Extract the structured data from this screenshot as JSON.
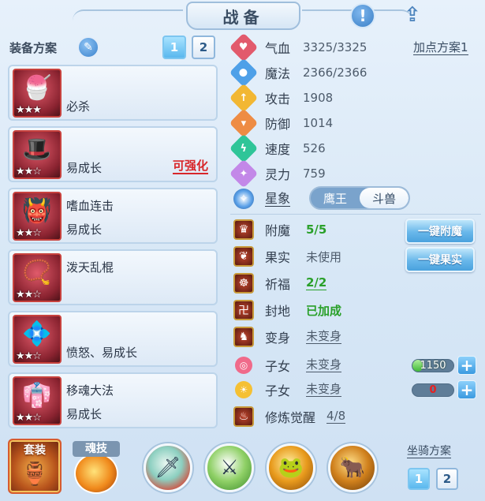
{
  "window": {
    "title": "战备"
  },
  "equip_scheme": {
    "label": "装备方案",
    "pages": [
      "1",
      "2"
    ],
    "active_page": 0
  },
  "equipment": [
    {
      "icon": "ice-popsicle-icon",
      "glyph": "🍧",
      "stars": "★★★",
      "top": "",
      "bottom": "必杀",
      "extra": ""
    },
    {
      "icon": "red-hat-icon",
      "glyph": "🎩",
      "stars": "★★☆",
      "top": "",
      "bottom": "易成长",
      "extra": "可强化"
    },
    {
      "icon": "demon-mask-icon",
      "glyph": "👹",
      "stars": "★★☆",
      "top": "嗜血连击",
      "bottom": "易成长",
      "extra": ""
    },
    {
      "icon": "gold-chain-icon",
      "glyph": "📿",
      "stars": "★★☆",
      "top": "泼天乱棍",
      "bottom": "",
      "extra": ""
    },
    {
      "icon": "jeweled-belt-icon",
      "glyph": "💠",
      "stars": "★★☆",
      "top": "",
      "bottom": "愤怒、易成长",
      "extra": ""
    },
    {
      "icon": "purple-robe-icon",
      "glyph": "👘",
      "stars": "★★☆",
      "top": "移魂大法",
      "bottom": "易成长",
      "extra": ""
    }
  ],
  "stats": [
    {
      "icon": "heart-icon",
      "symbol": "♥",
      "color": "#e25a6c",
      "name": "气血",
      "value": "3325/3325"
    },
    {
      "icon": "mana-icon",
      "symbol": "●",
      "color": "#4ea0e8",
      "name": "魔法",
      "value": "2366/2366"
    },
    {
      "icon": "attack-icon",
      "symbol": "↑",
      "color": "#f2b733",
      "name": "攻击",
      "value": "1908"
    },
    {
      "icon": "defense-icon",
      "symbol": "▾",
      "color": "#ee8c44",
      "name": "防御",
      "value": "1014"
    },
    {
      "icon": "speed-icon",
      "symbol": "ϟ",
      "color": "#2fc598",
      "name": "速度",
      "value": "526"
    },
    {
      "icon": "spirit-icon",
      "symbol": "✦",
      "color": "#c388e8",
      "name": "灵力",
      "value": "759"
    }
  ],
  "add_point_plan": "加点方案1",
  "star_sign": {
    "label": "星象",
    "options": [
      "鹰王",
      "斗兽"
    ],
    "selected": 1
  },
  "features": [
    {
      "icon": "enchant-icon",
      "symbol": "♛",
      "name": "附魔",
      "value": "5/5",
      "style": "green",
      "underline": false
    },
    {
      "icon": "fruit-icon",
      "symbol": "❦",
      "name": "果实",
      "value": "未使用",
      "style": "gray",
      "underline": false
    },
    {
      "icon": "blessing-icon",
      "symbol": "☸",
      "name": "祈福",
      "value": "2/2",
      "style": "green",
      "underline": true
    },
    {
      "icon": "seal-land-icon",
      "symbol": "卍",
      "name": "封地",
      "value": "已加成",
      "style": "green",
      "underline": false
    },
    {
      "icon": "transform-icon",
      "symbol": "♞",
      "name": "变身",
      "value": "未变身",
      "style": "gray",
      "underline": true
    }
  ],
  "buttons": {
    "enchant_all": "一键附魔",
    "fruit_all": "一键果实"
  },
  "children": [
    {
      "icon": "pink-swirl-icon",
      "symbol": "◎",
      "color": "#f06a8a",
      "name": "子女",
      "status": "未变身",
      "bar_value": "1150",
      "bar_fraction": 0.25,
      "text_style": "light"
    },
    {
      "icon": "gold-sun-icon",
      "symbol": "☀",
      "color": "#f5c033",
      "name": "子女",
      "status": "未变身",
      "bar_value": "0",
      "bar_fraction": 0,
      "text_style": "red"
    }
  ],
  "cultivation": {
    "icon": "cultivation-icon",
    "symbol": "♨",
    "name": "修炼觉醒",
    "value": "4/8"
  },
  "bottom": {
    "set_label": "套装",
    "soul_label": "魂技",
    "skills": [
      {
        "icon": "dragon-sword-icon",
        "glyph": "🗡"
      },
      {
        "icon": "green-blade-icon",
        "glyph": "⚔"
      },
      {
        "icon": "green-warrior-icon",
        "glyph": "🐸"
      },
      {
        "icon": "beast-charge-icon",
        "glyph": "🐂"
      }
    ],
    "mount_label": "坐骑方案",
    "mount_pages": [
      "1",
      "2"
    ],
    "mount_active": 0
  }
}
